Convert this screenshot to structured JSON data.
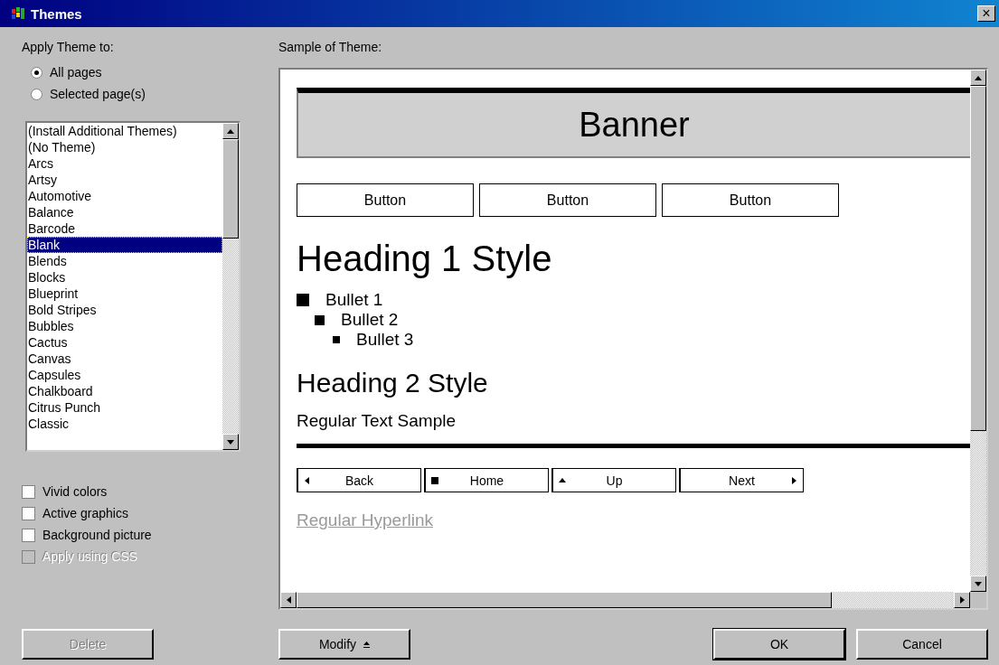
{
  "window": {
    "title": "Themes",
    "close": "×"
  },
  "apply_theme": {
    "label": "Apply Theme to:",
    "options": [
      {
        "label": "All pages",
        "selected": true
      },
      {
        "label": "Selected page(s)",
        "selected": false
      }
    ]
  },
  "themes": [
    {
      "label": "(Install Additional Themes)",
      "selected": false
    },
    {
      "label": "(No Theme)",
      "selected": false
    },
    {
      "label": "Arcs",
      "selected": false
    },
    {
      "label": "Artsy",
      "selected": false
    },
    {
      "label": "Automotive",
      "selected": false
    },
    {
      "label": "Balance",
      "selected": false
    },
    {
      "label": "Barcode",
      "selected": false
    },
    {
      "label": "Blank",
      "selected": true
    },
    {
      "label": "Blends",
      "selected": false
    },
    {
      "label": "Blocks",
      "selected": false
    },
    {
      "label": "Blueprint",
      "selected": false
    },
    {
      "label": "Bold Stripes",
      "selected": false
    },
    {
      "label": "Bubbles",
      "selected": false
    },
    {
      "label": "Cactus",
      "selected": false
    },
    {
      "label": "Canvas",
      "selected": false
    },
    {
      "label": "Capsules",
      "selected": false
    },
    {
      "label": "Chalkboard",
      "selected": false
    },
    {
      "label": "Citrus Punch",
      "selected": false
    },
    {
      "label": "Classic",
      "selected": false
    }
  ],
  "options": [
    {
      "label": "Vivid colors",
      "checked": false,
      "disabled": false
    },
    {
      "label": "Active graphics",
      "checked": false,
      "disabled": false
    },
    {
      "label": "Background picture",
      "checked": false,
      "disabled": false
    },
    {
      "label": "Apply using CSS",
      "checked": false,
      "disabled": true
    }
  ],
  "sample": {
    "label": "Sample of Theme:",
    "banner": "Banner",
    "buttons": [
      "Button",
      "Button",
      "Button"
    ],
    "heading1": "Heading 1 Style",
    "bullets": [
      {
        "label": "Bullet 1",
        "children": [
          {
            "label": "Bullet 2",
            "children": [
              {
                "label": "Bullet 3"
              }
            ]
          }
        ]
      }
    ],
    "heading2": "Heading 2 Style",
    "text": "Regular Text Sample",
    "nav": [
      {
        "label": "Back",
        "kind": "left"
      },
      {
        "label": "Home",
        "kind": "square"
      },
      {
        "label": "Up",
        "kind": "up"
      },
      {
        "label": "Next",
        "kind": "right"
      }
    ],
    "hyperlink": "Regular Hyperlink"
  },
  "buttons": [
    {
      "label": "Delete",
      "disabled": true
    },
    {
      "label": "Modify",
      "disabled": false
    },
    {
      "label": "OK",
      "disabled": false
    },
    {
      "label": "Cancel",
      "disabled": false
    }
  ]
}
